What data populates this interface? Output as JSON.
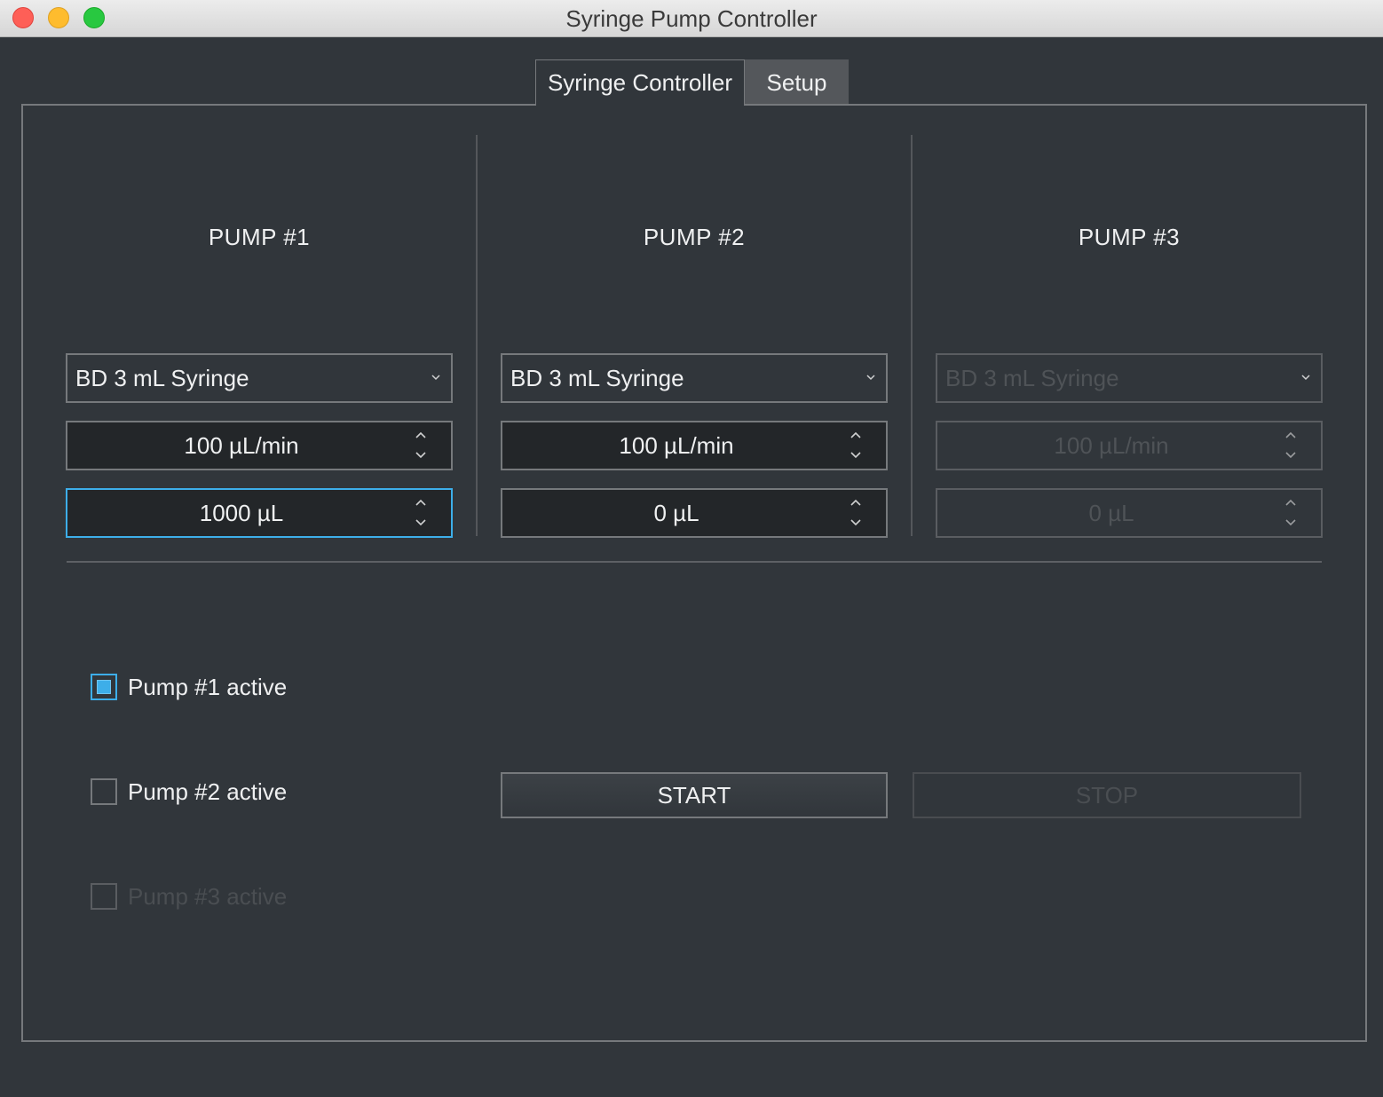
{
  "window": {
    "title": "Syringe Pump Controller"
  },
  "tabs": [
    {
      "label": "Syringe Controller",
      "active": true
    },
    {
      "label": "Setup",
      "active": false
    }
  ],
  "pumps": [
    {
      "title": "PUMP #1",
      "syringe": "BD 3 mL Syringe",
      "rate": "100 µL/min",
      "volume": "1000 µL",
      "enabled": true
    },
    {
      "title": "PUMP #2",
      "syringe": "BD 3 mL Syringe",
      "rate": "100 µL/min",
      "volume": "0 µL",
      "enabled": true
    },
    {
      "title": "PUMP #3",
      "syringe": "BD 3 mL Syringe",
      "rate": "100 µL/min",
      "volume": "0 µL",
      "enabled": false
    }
  ],
  "checkboxes": [
    {
      "label": "Pump #1 active",
      "checked": true,
      "enabled": true
    },
    {
      "label": "Pump #2 active",
      "checked": false,
      "enabled": true
    },
    {
      "label": "Pump #3 active",
      "checked": false,
      "enabled": false
    }
  ],
  "buttons": {
    "start": "START",
    "stop": "STOP"
  },
  "colors": {
    "background": "#31363b",
    "accent": "#3daee9",
    "field": "#232629",
    "border": "#76797c"
  }
}
